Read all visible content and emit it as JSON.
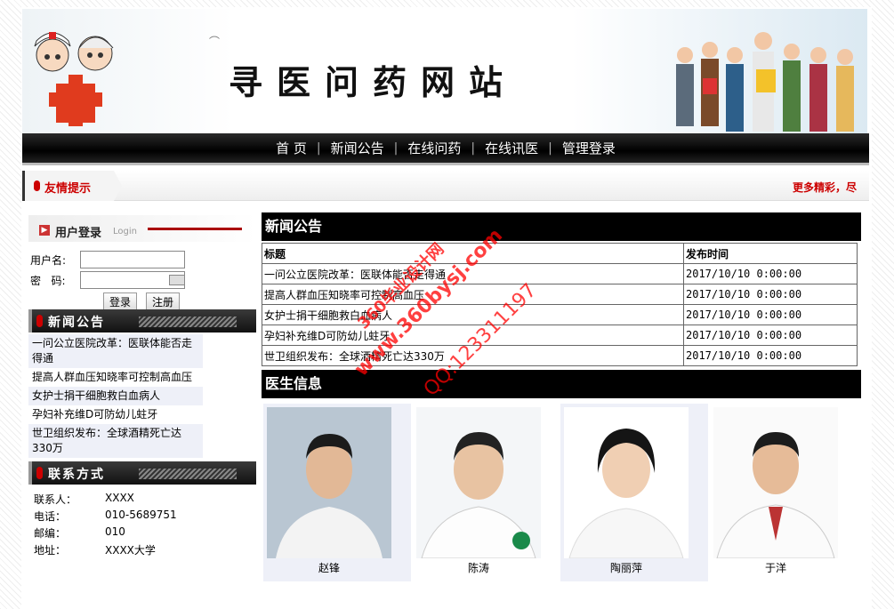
{
  "header": {
    "site_title": "寻医问药网站"
  },
  "nav": {
    "items": [
      "首 页",
      "新闻公告",
      "在线问药",
      "在线讯医",
      "管理登录"
    ]
  },
  "notice": {
    "label": "友情提示",
    "marquee": "更多精彩，尽"
  },
  "login": {
    "title": "用户登录",
    "subtitle": "Login",
    "username_label": "用户名:",
    "username_value": "",
    "password_label": "密   码:",
    "password_value": "",
    "login_button": "登录",
    "register_button": "注册"
  },
  "sidebar_news": {
    "title": "新闻公告",
    "items": [
      "一问公立医院改革：医联体能否走得通",
      "提高人群血压知晓率可控制高血压",
      "女护士捐干细胞救白血病人",
      "孕妇补充维D可防幼儿蛀牙",
      "世卫组织发布：全球酒精死亡达330万"
    ]
  },
  "contact": {
    "title": "联系方式",
    "rows": [
      {
        "k": "联系人：",
        "v": "XXXX"
      },
      {
        "k": "电话：",
        "v": "010-5689751"
      },
      {
        "k": "邮编：",
        "v": "010"
      },
      {
        "k": "地址：",
        "v": "XXXX大学"
      }
    ]
  },
  "news_section": {
    "title": "新闻公告",
    "columns": [
      "标题",
      "发布时间"
    ],
    "rows": [
      [
        "一问公立医院改革：医联体能否走得通",
        "2017/10/10 0:00:00"
      ],
      [
        "提高人群血压知晓率可控制高血压",
        "2017/10/10 0:00:00"
      ],
      [
        "女护士捐干细胞救白血病人",
        "2017/10/10 0:00:00"
      ],
      [
        "孕妇补充维D可防幼儿蛀牙",
        "2017/10/10 0:00:00"
      ],
      [
        "世卫组织发布：全球酒精死亡达330万",
        "2017/10/10 0:00:00"
      ]
    ]
  },
  "doctors_section": {
    "title": "医生信息",
    "doctors": [
      "赵锋",
      "陈涛",
      "陶丽萍",
      "于洋"
    ]
  },
  "watermark": {
    "line1": "360毕业设计网",
    "line2": "www.360bysj.com",
    "line3": "QQ:123311197"
  },
  "colors": {
    "accent_red": "#cc0000",
    "nav_bg": "#000000",
    "list_alt_bg": "#eef0f8"
  }
}
